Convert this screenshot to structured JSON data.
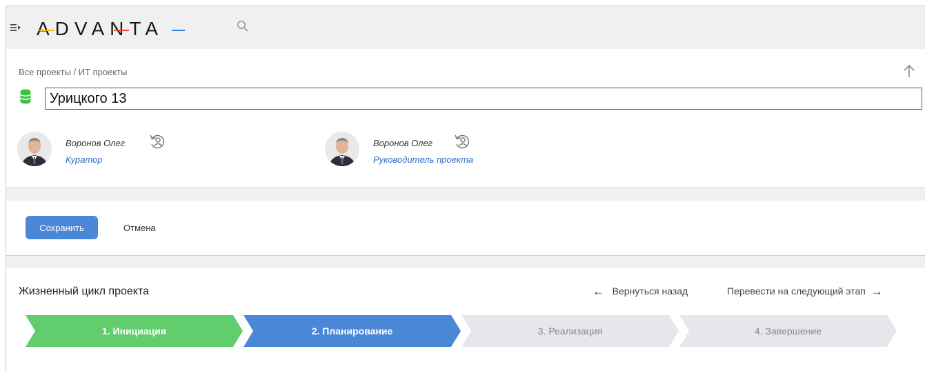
{
  "app": {
    "logo_text": "ADVANTA"
  },
  "breadcrumb": {
    "root": "Все проекты",
    "separator": "/",
    "current": "ИТ проекты"
  },
  "project": {
    "title": "Урицкого 13"
  },
  "people": [
    {
      "name": "Воронов Олег",
      "role": "Куратор"
    },
    {
      "name": "Воронов Олег",
      "role": "Руководитель проекта"
    }
  ],
  "actions": {
    "save_label": "Сохранить",
    "cancel_label": "Отмена"
  },
  "lifecycle": {
    "title": "Жизненный цикл проекта",
    "back_label": "Вернуться назад",
    "next_label": "Перевести на следующий этап",
    "stages": [
      {
        "label": "1. Инициация",
        "status": "done",
        "color": "#62cd6d",
        "text_color": "#ffffff"
      },
      {
        "label": "2. Планирование",
        "status": "current",
        "color": "#4a87d6",
        "text_color": "#ffffff"
      },
      {
        "label": "3. Реализация",
        "status": "pending",
        "color": "#e5e7ea",
        "text_color": "#8a8a8a"
      },
      {
        "label": "4. Завершение",
        "status": "pending",
        "color": "#e5e7ea",
        "text_color": "#8a8a8a"
      }
    ]
  },
  "icons": {
    "menu": "menu-expand-icon",
    "search": "search-icon",
    "up": "arrow-up-icon",
    "project": "database-icon",
    "swap": "person-swap-icon",
    "back": "arrow-left-icon",
    "next": "arrow-right-icon"
  },
  "colors": {
    "accent": "#4a87d6",
    "link": "#2f6fc4",
    "project_icon": "#3cc43f"
  }
}
